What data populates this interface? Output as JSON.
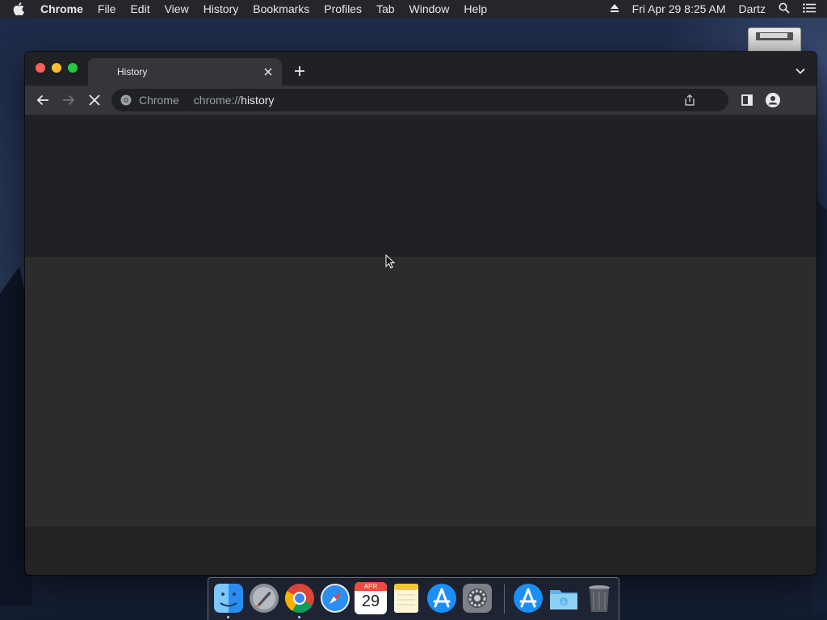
{
  "menubar": {
    "app_name": "Chrome",
    "items": [
      "File",
      "Edit",
      "View",
      "History",
      "Bookmarks",
      "Profiles",
      "Tab",
      "Window",
      "Help"
    ],
    "clock": "Fri Apr 29  8:25 AM",
    "user": "Dartz"
  },
  "browser": {
    "tab_title": "History",
    "omnibox": {
      "chip": "Chrome",
      "scheme": "chrome://",
      "host": "history"
    }
  },
  "dock": {
    "calendar_month": "APR",
    "calendar_day": "29",
    "items": [
      "finder-icon",
      "launchpad-icon",
      "chrome-icon",
      "safari-icon",
      "calendar-icon",
      "notes-icon",
      "app-store-icon",
      "system-preferences-icon",
      "app-store-downloads-icon",
      "downloads-folder-icon",
      "trash-icon"
    ]
  },
  "colors": {
    "window_bg": "#202124",
    "toolbar_bg": "#35363a",
    "content_mid": "#2c2c2c",
    "close": "#ff5f57",
    "minimize": "#febc2e",
    "maximize": "#28c840"
  }
}
